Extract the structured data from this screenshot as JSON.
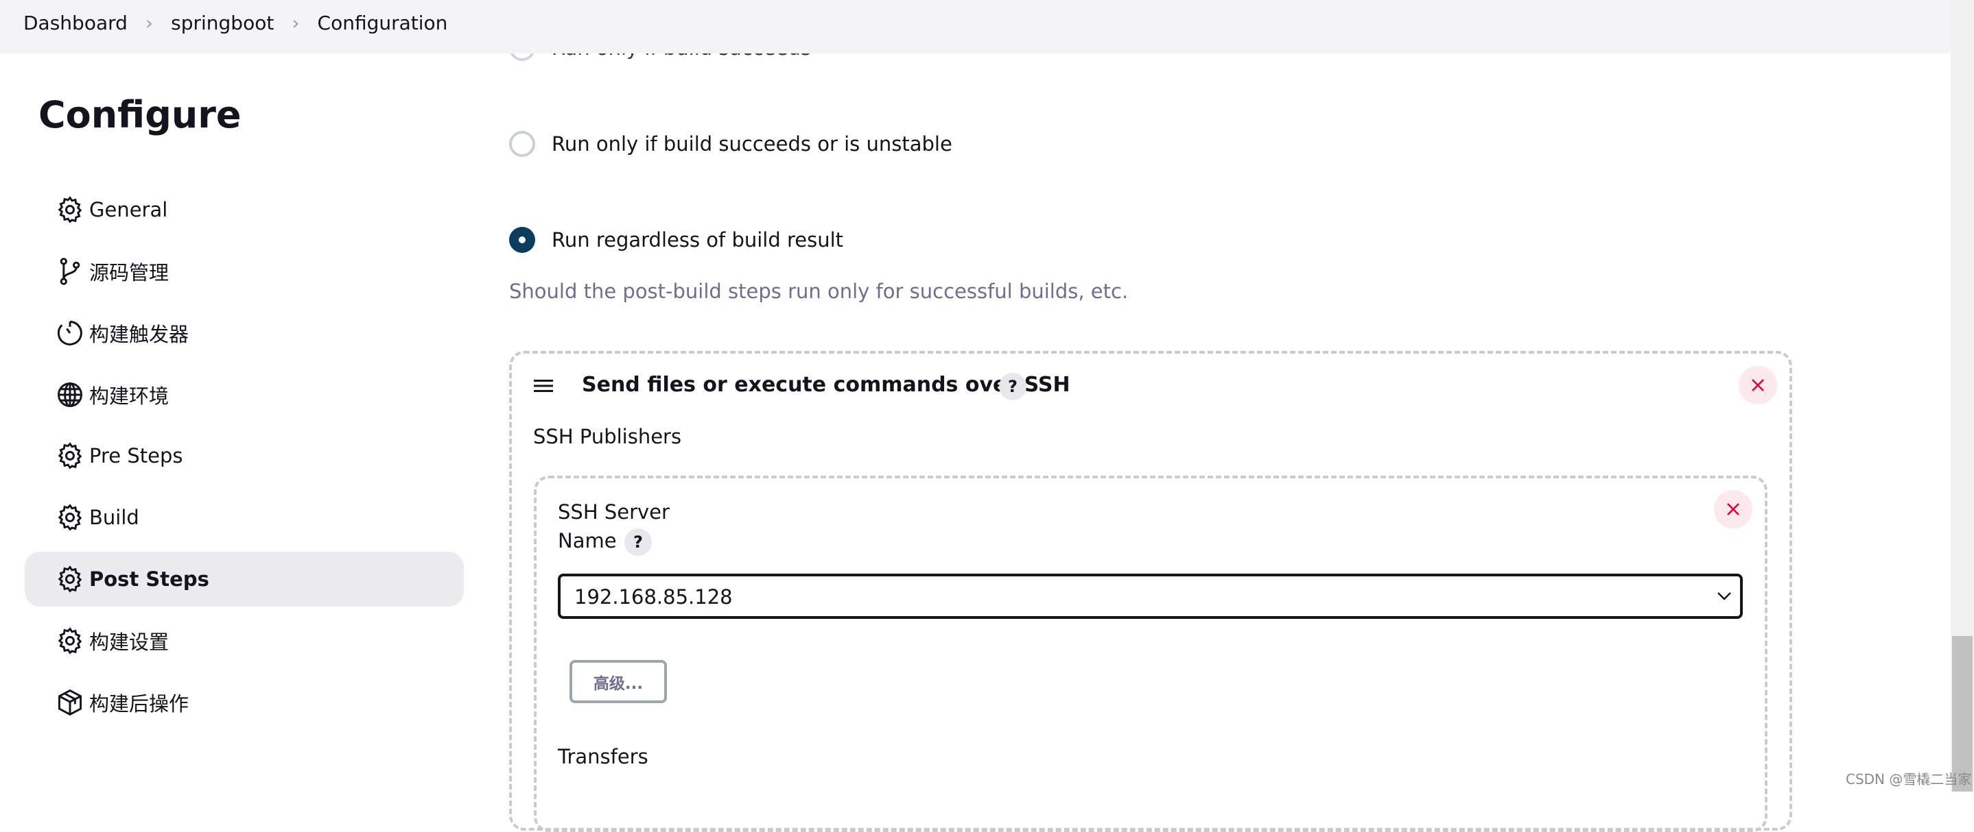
{
  "breadcrumb": [
    "Dashboard",
    "springboot",
    "Configuration"
  ],
  "breadcrumb_separator": ">",
  "page_title": "Configure",
  "sidebar": {
    "items": [
      {
        "label": "General",
        "icon": "gear-icon",
        "active": false
      },
      {
        "label": "源码管理",
        "icon": "git-branch-icon",
        "active": false
      },
      {
        "label": "构建触发器",
        "icon": "timer-icon",
        "active": false
      },
      {
        "label": "构建环境",
        "icon": "globe-icon",
        "active": false
      },
      {
        "label": "Pre Steps",
        "icon": "gear-icon",
        "active": false
      },
      {
        "label": "Build",
        "icon": "gear-icon",
        "active": false
      },
      {
        "label": "Post Steps",
        "icon": "gear-icon",
        "active": true
      },
      {
        "label": "构建设置",
        "icon": "gear-icon",
        "active": false
      },
      {
        "label": "构建后操作",
        "icon": "package-icon",
        "active": false
      }
    ]
  },
  "post_steps": {
    "options": [
      {
        "label": "Run only if build succeeds",
        "checked": false
      },
      {
        "label": "Run only if build succeeds or is unstable",
        "checked": false
      },
      {
        "label": "Run regardless of build result",
        "checked": true
      }
    ],
    "help_text": "Should the post-build steps run only for successful builds, etc."
  },
  "ssh_step": {
    "title": "Send files or execute commands over SSH",
    "help": "?",
    "publishers_label": "SSH Publishers",
    "server_label": "SSH Server",
    "name_label": "Name",
    "name_help": "?",
    "server_name_value": "192.168.85.128",
    "advanced_button": "高级...",
    "transfers_label": "Transfers"
  },
  "colors": {
    "accent": "#0b3b5e",
    "close": "#e6002e",
    "close_bg": "#fbe9ec"
  },
  "watermark": "CSDN @雪橇二当家"
}
